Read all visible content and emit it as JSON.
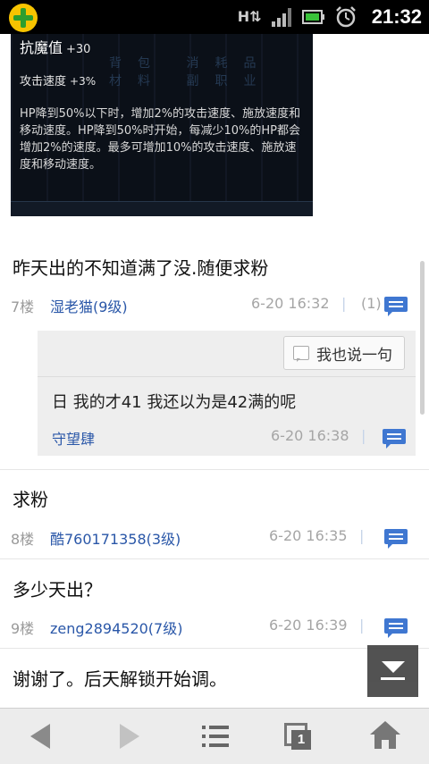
{
  "status_bar": {
    "time": "21:32",
    "icons": [
      "app-plus-icon",
      "hspa-icon",
      "signal-icon",
      "battery-icon",
      "alarm-clock-icon"
    ]
  },
  "game_screenshot": {
    "line1_label": "抗魔值",
    "line1_value": "+30",
    "line2_label": "攻击速度",
    "line2_value": "+3%",
    "ghost_tabs": "背包 消耗品 材料 副职业",
    "description": "HP降到50%以下时，增加2%的攻击速度、施放速度和移动速度。HP降到50%时开始，每减少10%的HP都会增加2%的速度。最多可增加10%的攻击速度、施放速度和移动速度。"
  },
  "posts": [
    {
      "text": "昨天出的不知道满了没.随便求粉",
      "floor": "7楼",
      "author": "湿老猫(9级)",
      "time": "6-20 16:32",
      "separator": "|",
      "reply_count": "(1)"
    },
    {
      "text": "求粉",
      "floor": "8楼",
      "author": "酷760171358(3级)",
      "time": "6-20 16:35",
      "separator": "|"
    },
    {
      "text": "多少天出？",
      "floor": "9楼",
      "author": "zeng2894520(7级)",
      "time": "6-20 16:39",
      "separator": "|"
    },
    {
      "text": "谢谢了。后天解锁开始调。"
    }
  ],
  "sub_reply": {
    "say_button_label": "我也说一句",
    "text": "日 我的才41 我还以为是42满的呢",
    "author": "守望肆",
    "time": "6-20 16:38",
    "separator": "|"
  },
  "toolbar": {
    "windows_count": "1"
  }
}
